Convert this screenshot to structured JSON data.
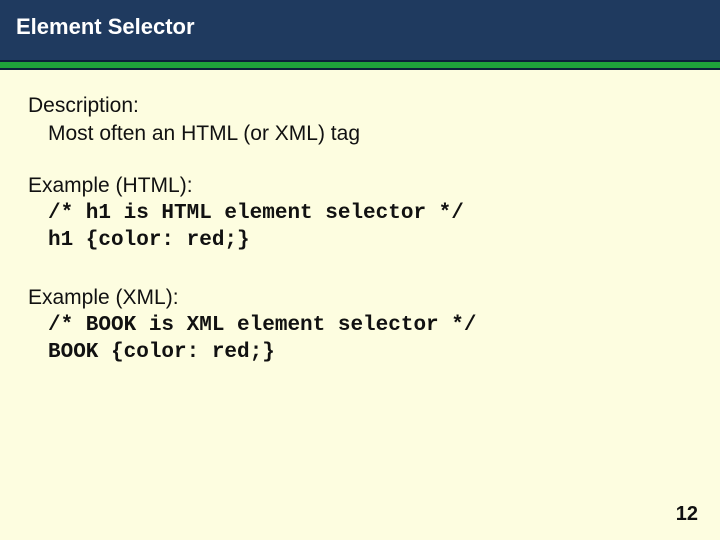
{
  "header": {
    "title": "Element Selector"
  },
  "sections": {
    "description": {
      "label": "Description:",
      "text": "Most often an HTML (or XML) tag"
    },
    "example_html": {
      "label": "Example (HTML):",
      "code1": "/* h1 is HTML element selector */",
      "code2": "h1 {color: red;}"
    },
    "example_xml": {
      "label": "Example (XML):",
      "code1": "/* BOOK is XML element selector */",
      "code2": "BOOK {color: red;}"
    }
  },
  "page_number": "12"
}
